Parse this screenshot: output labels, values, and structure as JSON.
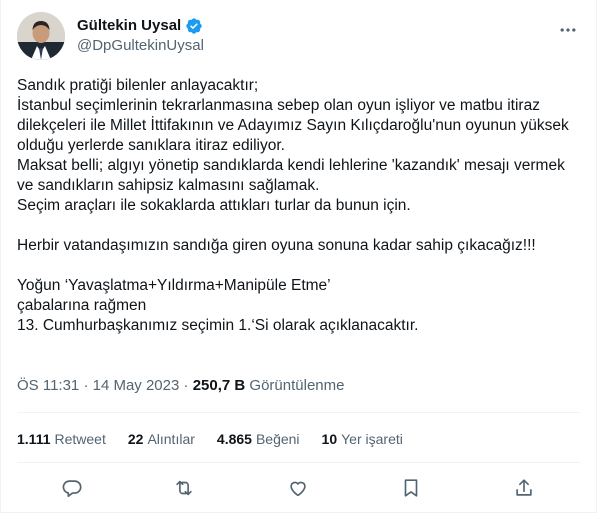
{
  "author": {
    "name": "Gültekin Uysal",
    "handle": "@DpGultekinUysal"
  },
  "tweet": {
    "text": "Sandık pratiği bilenler anlayacaktır;\nİstanbul seçimlerinin tekrarlanmasına sebep olan oyun işliyor ve matbu itiraz dilekçeleri ile Millet İttifakının ve Adayımız Sayın Kılıçdaroğlu'nun oyunun yüksek olduğu yerlerde sanıklara itiraz ediliyor.\nMaksat belli; algıyı yönetip sandıklarda kendi lehlerine 'kazandık' mesajı vermek ve sandıkların sahipsiz kalmasını sağlamak.\nSeçim araçları ile sokaklarda attıkları turlar da bunun için.\n\nHerbir vatandaşımızın sandığa giren oyuna sonuna kadar sahip çıkacağız!!!\n\nYoğun ‘Yavaşlatma+Yıldırma+Manipüle Etme’\nçabalarına rağmen\n13. Cumhurbaşkanımız seçimin 1.‘Si olarak açıklanacaktır."
  },
  "meta": {
    "time": "ÖS 11:31",
    "separator": "·",
    "date": "14 May 2023",
    "views_count": "250,7 B",
    "views_label": "Görüntülenme"
  },
  "stats": [
    {
      "count": "1.111",
      "label": "Retweet"
    },
    {
      "count": "22",
      "label": "Alıntılar"
    },
    {
      "count": "4.865",
      "label": "Beğeni"
    },
    {
      "count": "10",
      "label": "Yer işareti"
    }
  ],
  "colors": {
    "verified": "#1d9bf0",
    "secondary_text": "#536471",
    "divider": "#eff3f4"
  },
  "icons": [
    "verified-badge-icon",
    "more-icon",
    "reply-icon",
    "retweet-icon",
    "like-icon",
    "bookmark-icon",
    "share-icon"
  ]
}
